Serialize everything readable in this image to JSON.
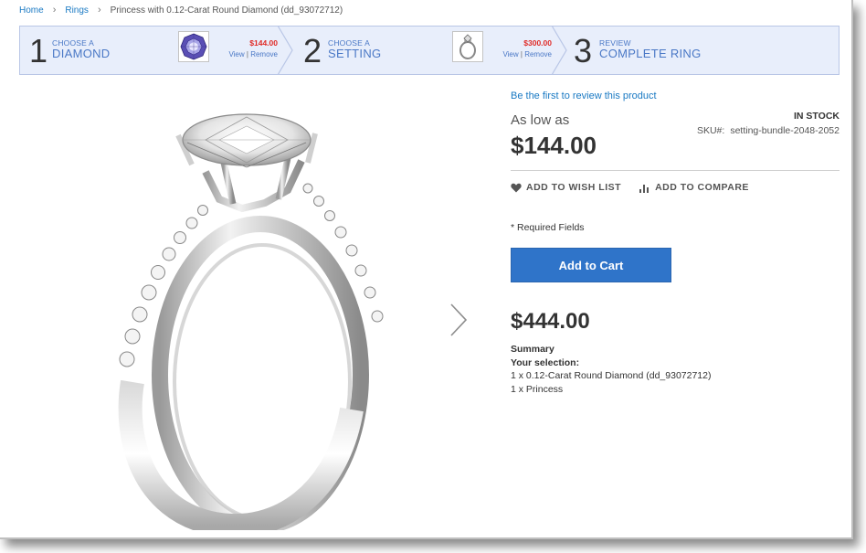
{
  "breadcrumb": {
    "home": "Home",
    "rings": "Rings",
    "current": "Princess with 0.12-Carat Round Diamond (dd_93072712)"
  },
  "steps": [
    {
      "number": "1",
      "small": "CHOOSE A",
      "big": "DIAMOND",
      "price": "$144.00",
      "view": "View",
      "remove": "Remove",
      "thumb_icon": "diamond-icon"
    },
    {
      "number": "2",
      "small": "CHOOSE A",
      "big": "SETTING",
      "price": "$300.00",
      "view": "View",
      "remove": "Remove",
      "thumb_icon": "ring-setting-icon"
    },
    {
      "number": "3",
      "small": "REVIEW",
      "big": "COMPLETE RING"
    }
  ],
  "product": {
    "review_link": "Be the first to review this product",
    "as_low_as": "As low as",
    "price": "$144.00",
    "stock": "IN STOCK",
    "sku_label": "SKU#:",
    "sku_value": "setting-bundle-2048-2052",
    "wishlist": "ADD TO WISH LIST",
    "compare": "ADD TO COMPARE",
    "required": "* Required Fields",
    "add_to_cart": "Add to Cart",
    "total": "$444.00",
    "summary_title": "Summary",
    "selection_title": "Your selection:",
    "selection_items": [
      "1 x 0.12-Carat Round Diamond (dd_93072712)",
      "1 x Princess"
    ]
  },
  "colors": {
    "accent": "#2f74c9",
    "link": "#1979c3",
    "price_red": "#e02b27",
    "step_bg": "#e8eefb"
  }
}
